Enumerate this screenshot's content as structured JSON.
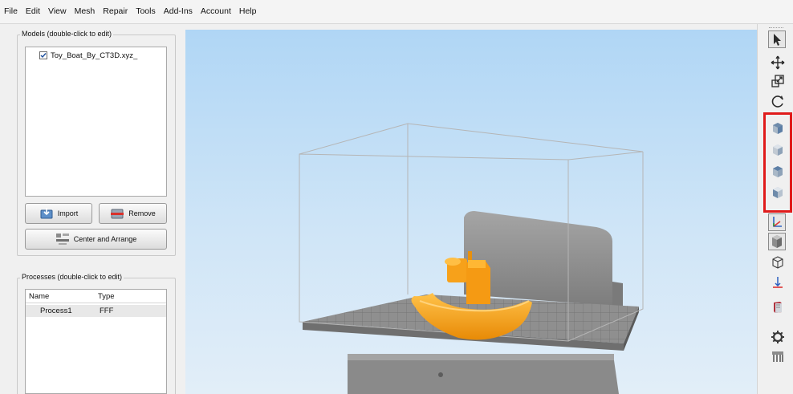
{
  "menu": [
    "File",
    "Edit",
    "View",
    "Mesh",
    "Repair",
    "Tools",
    "Add-Ins",
    "Account",
    "Help"
  ],
  "models_panel": {
    "title": "Models (double-click to edit)",
    "items": [
      {
        "name": "Toy_Boat_By_CT3D.xyz_",
        "checked": true
      }
    ],
    "import_label": "Import",
    "remove_label": "Remove",
    "center_label": "Center and Arrange"
  },
  "processes_panel": {
    "title": "Processes (double-click to edit)",
    "columns": [
      "Name",
      "Type"
    ],
    "rows": [
      {
        "name": "Process1",
        "type": "FFF"
      }
    ]
  },
  "toolbar": {
    "tools": [
      "select-arrow-icon",
      "move-icon",
      "scale-icon",
      "rotate-icon",
      "view-front-cube-icon",
      "view-right-cube-icon",
      "view-top-cube-icon",
      "view-bottom-cube-icon",
      "axis-icon",
      "solid-view-icon",
      "wireframe-view-icon",
      "place-on-bed-icon",
      "book-icon",
      "settings-gear-icon",
      "supports-icon"
    ],
    "highlighted_group": [
      "view-front-cube-icon",
      "view-right-cube-icon",
      "view-top-cube-icon",
      "view-bottom-cube-icon"
    ]
  },
  "colors": {
    "model": "#f7a11a",
    "bed": "#8f8f8f",
    "highlight": "#e01b1b",
    "viewport_top": "#b0d6f5"
  }
}
